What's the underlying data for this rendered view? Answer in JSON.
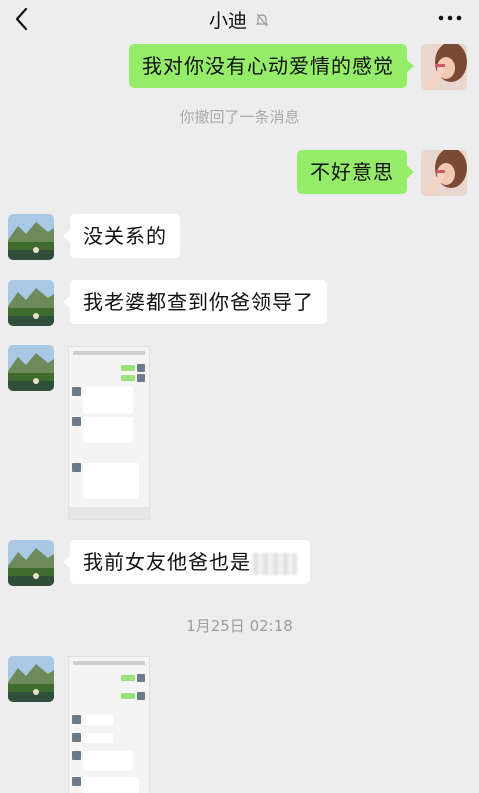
{
  "header": {
    "title": "小迪",
    "back_icon": "chevron-left-icon",
    "mute_icon": "bell-muted-icon",
    "more_icon": "more-dots-icon"
  },
  "messages": {
    "m1": "我对你没有心动爱情的感觉",
    "recalled": "你撤回了一条消息",
    "m2": "不好意思",
    "m3": "没关系的",
    "m4": "我老婆都查到你爸领导了",
    "m5": "我前女友他爸也是",
    "time": "1月25日 02:18"
  },
  "colors": {
    "background": "#ededed",
    "my_bubble": "#95ec69",
    "their_bubble": "#ffffff",
    "system_text": "#a8a8a8"
  }
}
